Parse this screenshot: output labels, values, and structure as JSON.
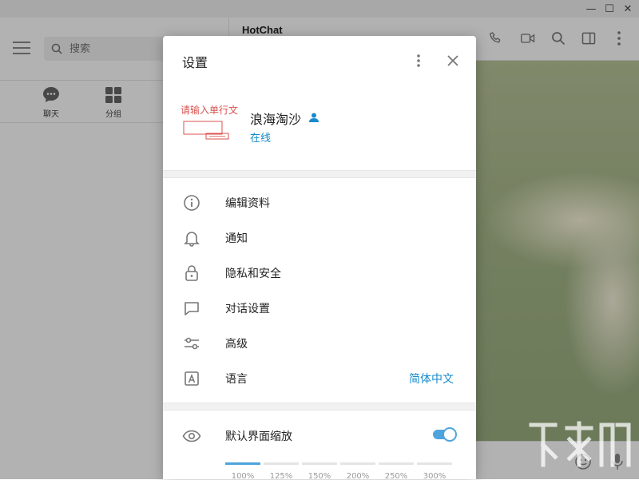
{
  "window": {
    "controls": {
      "minimize": "—",
      "maximize": "☐",
      "close": "✕"
    }
  },
  "sidebar": {
    "search_placeholder": "搜索",
    "tabs": [
      {
        "label": "聊天",
        "icon": "chat-bubble-icon"
      },
      {
        "label": "分组",
        "icon": "grid-icon"
      }
    ]
  },
  "chat": {
    "title": "HotChat",
    "header_icons": [
      "phone-icon",
      "video-icon",
      "search-icon",
      "sidebar-toggle-icon",
      "more-vertical-icon"
    ]
  },
  "settings": {
    "title": "设置",
    "profile": {
      "avatar_text": "请输入单行文",
      "name": "浪海淘沙",
      "status": "在线"
    },
    "menu": [
      {
        "label": "编辑资料",
        "icon": "info-icon"
      },
      {
        "label": "通知",
        "icon": "bell-icon"
      },
      {
        "label": "隐私和安全",
        "icon": "lock-icon"
      },
      {
        "label": "对话设置",
        "icon": "chat-icon"
      },
      {
        "label": "高级",
        "icon": "sliders-icon"
      },
      {
        "label": "语言",
        "icon": "language-icon",
        "value": "简体中文"
      }
    ],
    "scale": {
      "label": "默认界面缩放",
      "enabled": true,
      "options": [
        "100%",
        "125%",
        "150%",
        "200%",
        "250%",
        "300%"
      ],
      "selected_index": 0
    }
  },
  "colors": {
    "accent": "#168acd",
    "toggle": "#4ea4dc"
  }
}
